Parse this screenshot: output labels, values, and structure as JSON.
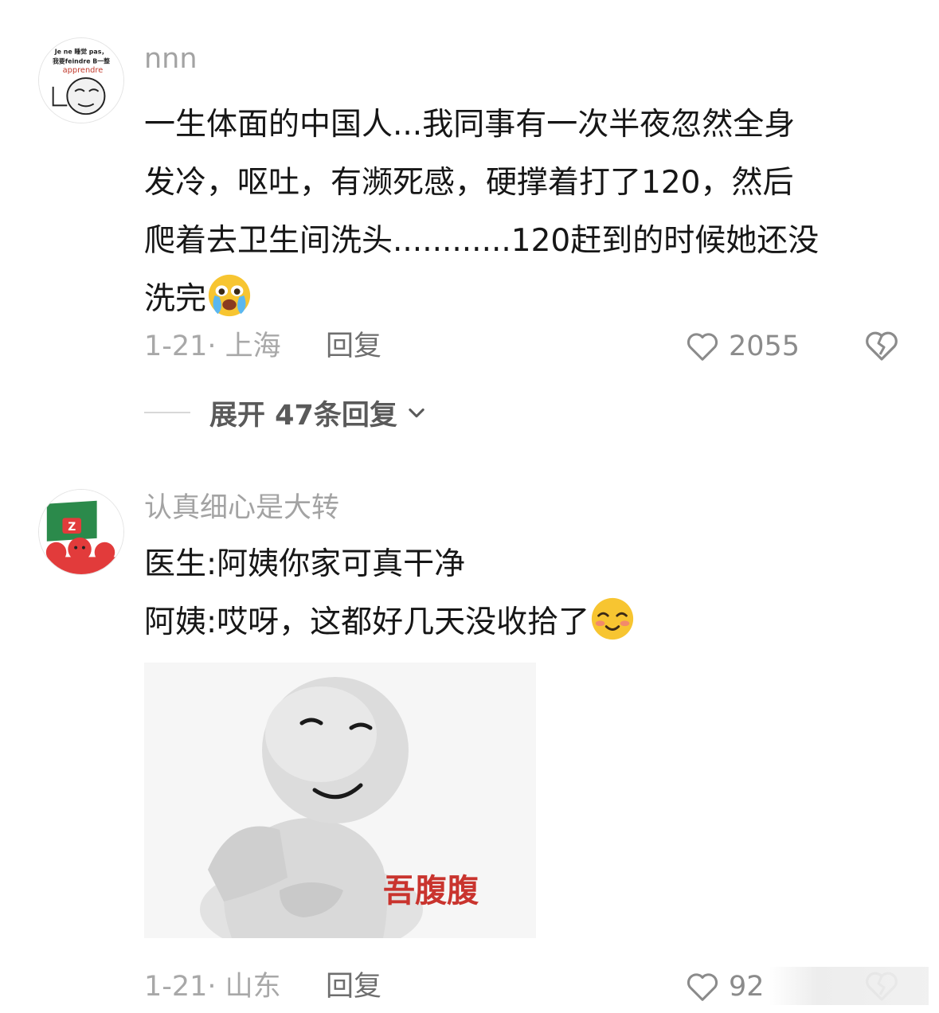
{
  "comments": [
    {
      "username": "nnn",
      "avatar_lines": [
        "Je ne 睡觉 pas，",
        "我要feindre B一整",
        "apprendre"
      ],
      "lines": [
        "一生体面的中国人...我同事有一次半夜忽然全身",
        "发冷，呕吐，有濒死感，硬撑着打了120，然后",
        "爬着去卫生间洗头............120赶到的时候她还没",
        "洗完"
      ],
      "emoji": "crying-emoji",
      "date": "1-21· 上海",
      "reply_label": "回复",
      "likes": "2055",
      "expand_label": "展开 47条回复"
    },
    {
      "username": "认真细心是大转",
      "lines": [
        "医生:阿姨你家可真干净",
        "阿姨:哎呀，这都好几天没收拾了"
      ],
      "emoji": "shy-smile-emoji",
      "sticker_caption": "吾腹腹",
      "date": "1-21· 山东",
      "reply_label": "回复",
      "likes": "92"
    }
  ],
  "icons": {
    "like": "heart-outline-icon",
    "dislike": "broken-heart-icon",
    "expand": "chevron-down-icon"
  },
  "colors": {
    "username": "#a3a3a3",
    "meta": "#a8a8a8",
    "text": "#161616",
    "sticker_caption": "#c9342e"
  }
}
